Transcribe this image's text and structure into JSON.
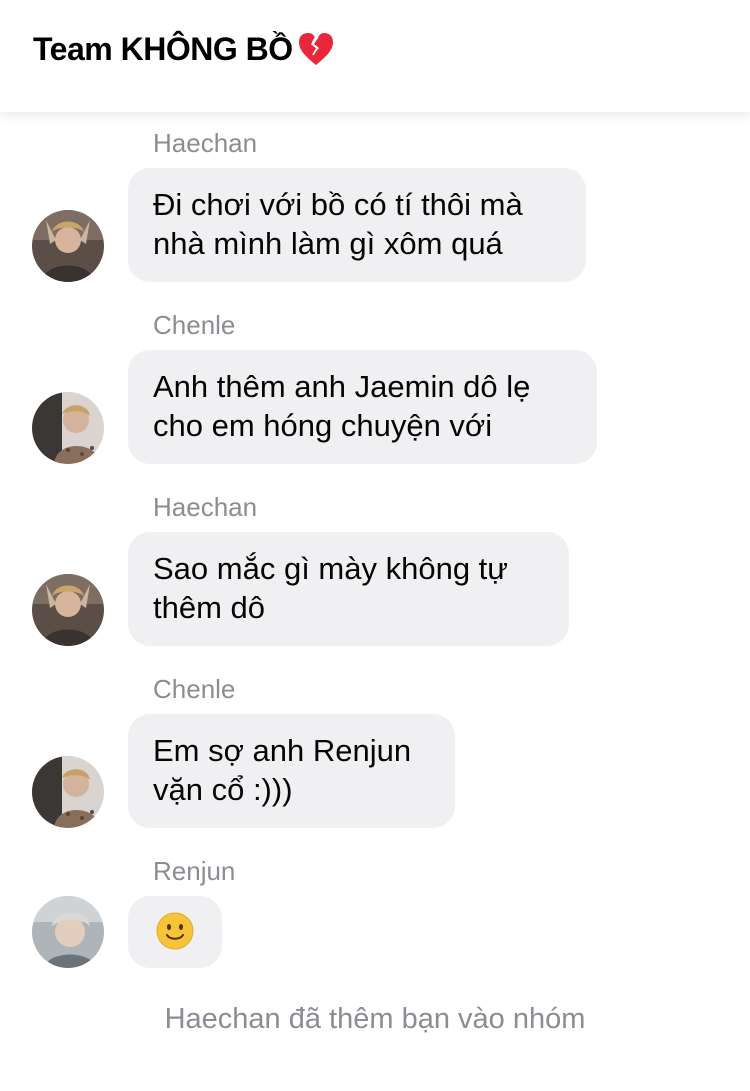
{
  "header": {
    "title": "Team KHÔNG BỒ",
    "title_emoji_icon": "broken-heart-icon"
  },
  "messages": [
    {
      "sender": "Haechan",
      "avatar": "avatar-haechan",
      "lines": [
        "Đi chơi với bồ có tí thôi mà",
        "nhà mình làm gì xôm quá"
      ]
    },
    {
      "sender": "Chenle",
      "avatar": "avatar-chenle",
      "lines": [
        "Anh thêm anh Jaemin dô lẹ",
        "cho em hóng chuyện với"
      ]
    },
    {
      "sender": "Haechan",
      "avatar": "avatar-haechan",
      "lines": [
        "Sao mắc gì mày không tự",
        "thêm dô"
      ]
    },
    {
      "sender": "Chenle",
      "avatar": "avatar-chenle",
      "lines": [
        "Em sợ anh Renjun",
        "vặn cổ :)))"
      ]
    },
    {
      "sender": "Renjun",
      "avatar": "avatar-renjun",
      "emoji_icon": "slightly-smiling-face-icon"
    }
  ],
  "system_note": "Haechan đã thêm bạn vào nhóm",
  "colors": {
    "bubble_bg": "#f0f0f2",
    "sender_text": "#8a8d91",
    "message_text": "#050505",
    "broken_heart": "#e8283a",
    "smile_face": "#f7c437"
  }
}
